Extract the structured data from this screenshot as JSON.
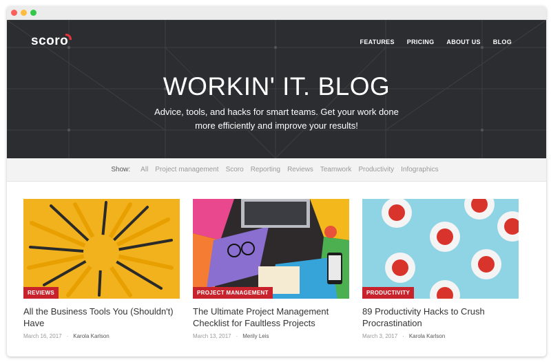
{
  "header": {
    "logo": "scoro",
    "nav": [
      "FEATURES",
      "PRICING",
      "ABOUT US",
      "BLOG"
    ]
  },
  "hero": {
    "title": "WORKIN' IT. BLOG",
    "subtitle_line1": "Advice, tools, and hacks for smart teams. Get your work done",
    "subtitle_line2": "more efficiently and improve your results!"
  },
  "filter": {
    "label": "Show:",
    "options": [
      "All",
      "Project management",
      "Scoro",
      "Reporting",
      "Reviews",
      "Teamwork",
      "Productivity",
      "Infographics"
    ]
  },
  "posts": [
    {
      "tag": "REVIEWS",
      "title": "All the Business Tools You (Shouldn't) Have",
      "date": "March 16, 2017",
      "author": "Karola Karlson",
      "image": "yellow-tools-image"
    },
    {
      "tag": "PROJECT MANAGEMENT",
      "title": "The Ultimate Project Management Checklist for Faultless Projects",
      "date": "March 13, 2017",
      "author": "Merily Leis",
      "image": "colorful-desk-laptop-image"
    },
    {
      "tag": "PRODUCTIVITY",
      "title": "89 Productivity Hacks to Crush Procrastination",
      "date": "March 3, 2017",
      "author": "Karola Karlson",
      "image": "tea-cups-image"
    }
  ],
  "colors": {
    "accent": "#c8232c",
    "hero_bg": "#2c2d31",
    "filter_bg": "#f3f3f3"
  }
}
